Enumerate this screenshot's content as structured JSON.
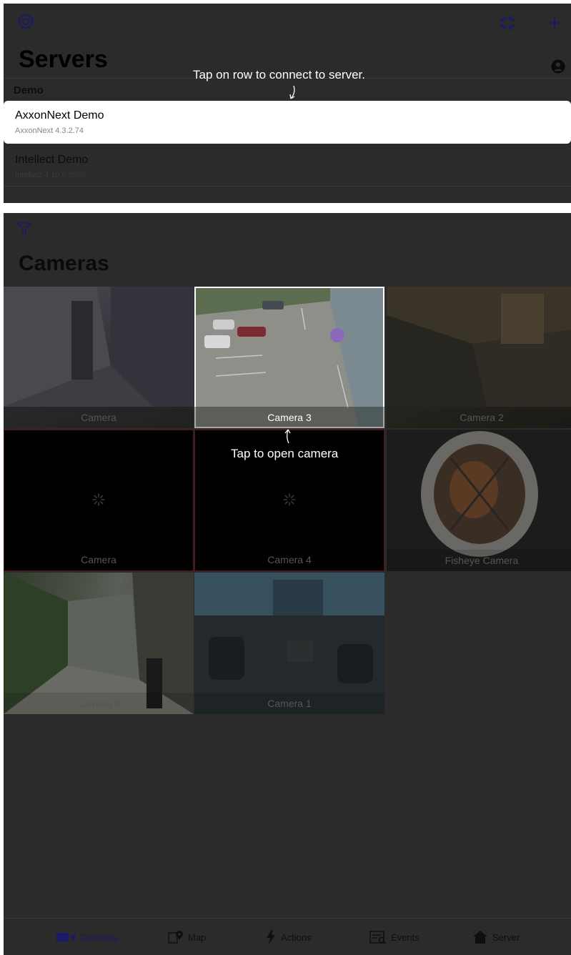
{
  "servers": {
    "title": "Servers",
    "hint": "Tap on row to connect to server.",
    "group": "Demo",
    "rows": [
      {
        "name": "AxxonNext Demo",
        "version": "AxxonNext 4.3.2.74"
      },
      {
        "name": "Intellect Demo",
        "version": "Intellect 4.10.5.3588"
      }
    ]
  },
  "cameras": {
    "title": "Cameras",
    "hint": "Tap to open camera",
    "tiles": [
      {
        "label": "Camera"
      },
      {
        "label": "Camera 3"
      },
      {
        "label": "Camera 2"
      },
      {
        "label": "Camera"
      },
      {
        "label": "Camera 4"
      },
      {
        "label": "Fisheye Camera"
      },
      {
        "label": "Camera 6"
      },
      {
        "label": "Camera 1"
      }
    ]
  },
  "tabs": [
    {
      "label": "Cameras",
      "icon": "video-camera-icon"
    },
    {
      "label": "Map",
      "icon": "map-pin-icon"
    },
    {
      "label": "Actions",
      "icon": "lightning-icon"
    },
    {
      "label": "Events",
      "icon": "events-list-icon"
    },
    {
      "label": "Server",
      "icon": "server-house-icon"
    }
  ],
  "colors": {
    "accent": "#1a1a6a",
    "dim_overlay": "#2b2b2b",
    "highlight": "#ffffff",
    "error_border": "#5a1010"
  }
}
